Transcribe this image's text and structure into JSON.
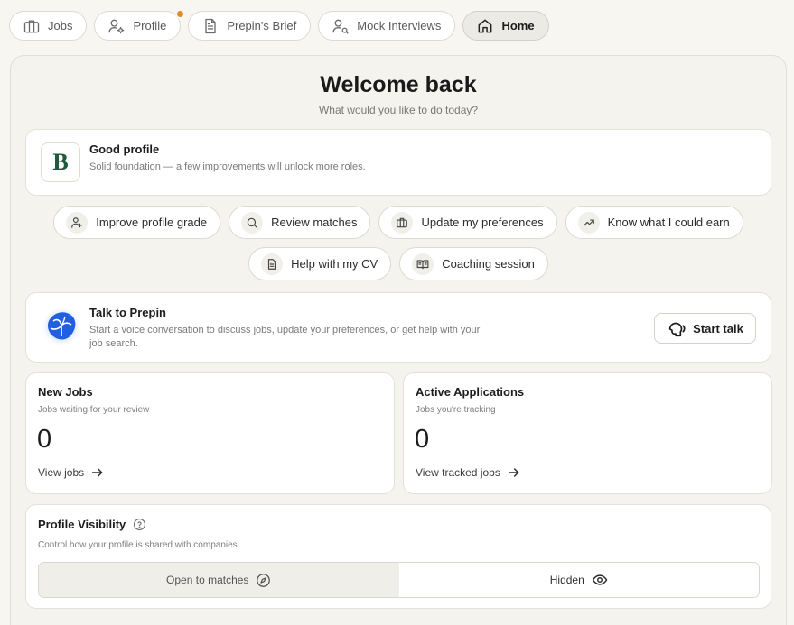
{
  "nav": {
    "tabs": [
      {
        "label": "Jobs",
        "icon": "briefcase-icon"
      },
      {
        "label": "Profile",
        "icon": "user-gear-icon",
        "notification": true
      },
      {
        "label": "Prepin's Brief",
        "icon": "document-icon"
      },
      {
        "label": "Mock Interviews",
        "icon": "user-settings-icon"
      },
      {
        "label": "Home",
        "icon": "home-icon",
        "active": true
      }
    ]
  },
  "header": {
    "title": "Welcome back",
    "subtitle": "What would you like to do today?"
  },
  "profile_grade": {
    "grade": "B",
    "title": "Good profile",
    "description": "Solid foundation — a few improvements will unlock more roles."
  },
  "actions": [
    {
      "label": "Improve profile grade",
      "icon": "user-plus-icon"
    },
    {
      "label": "Review matches",
      "icon": "search-icon"
    },
    {
      "label": "Update my preferences",
      "icon": "briefcase-icon"
    },
    {
      "label": "Know what I could earn",
      "icon": "trending-up-icon"
    },
    {
      "label": "Help with my CV",
      "icon": "document-icon"
    },
    {
      "label": "Coaching session",
      "icon": "book-open-icon"
    }
  ],
  "talk": {
    "title": "Talk to Prepin",
    "description": "Start a voice conversation to discuss jobs, update your preferences, or get help with your job search.",
    "button_label": "Start talk"
  },
  "stats": {
    "new_jobs": {
      "title": "New Jobs",
      "subtitle": "Jobs waiting for your review",
      "value": "0",
      "link": "View jobs"
    },
    "active_applications": {
      "title": "Active Applications",
      "subtitle": "Jobs you're tracking",
      "value": "0",
      "link": "View tracked jobs"
    }
  },
  "visibility": {
    "title": "Profile Visibility",
    "subtitle": "Control how your profile is shared with companies",
    "options": [
      {
        "label": "Open to matches",
        "icon": "compass-icon",
        "selected": true
      },
      {
        "label": "Hidden",
        "icon": "eye-icon",
        "selected": false
      }
    ]
  },
  "colors": {
    "background": "#f7f6f1",
    "panel": "#f4f3ee",
    "grade_text": "#1e5a3c",
    "notification_dot": "#e38a2c",
    "blob_blue": "#1f5fe0"
  }
}
